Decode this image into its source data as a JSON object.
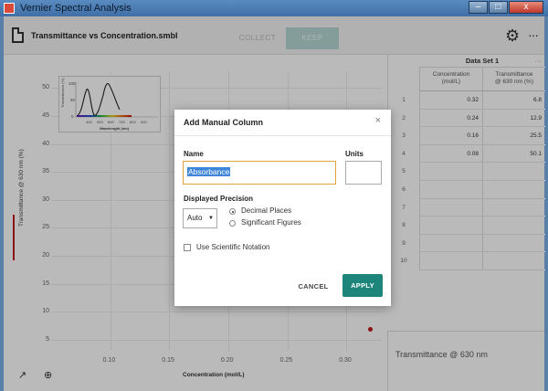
{
  "window": {
    "title": "Vernier Spectral Analysis",
    "buttons": [
      "–",
      "□",
      "x"
    ]
  },
  "toolbar": {
    "file_title": "Transmittance vs Concentration.smbl",
    "collect_label": "COLLECT",
    "keep_label": "KEEP",
    "settings_icon": "gear-icon",
    "more_icon": "ellipsis-icon",
    "more_label": "···",
    "gear_glyph": "⚙"
  },
  "graph": {
    "ylabel": "Transmittance @ 630 nm (%)",
    "xlabel": "Concentration (mol/L)",
    "yticks": [
      "50",
      "45",
      "40",
      "35",
      "30",
      "25",
      "20",
      "15",
      "10",
      "5"
    ],
    "xticks": [
      "0.10",
      "0.15",
      "0.20",
      "0.25",
      "0.30"
    ],
    "inset": {
      "ylabel": "Transmittance (%)",
      "xlabel": "Wavelength (nm)",
      "yticks": [
        "100",
        "50",
        "0"
      ],
      "xticks": [
        "400",
        "500",
        "600",
        "700",
        "800",
        "900"
      ]
    },
    "tools": {
      "graph_icon": "↗",
      "zoom_icon": "⊕"
    }
  },
  "chart_data": {
    "type": "scatter",
    "xlabel": "Concentration (mol/L)",
    "ylabel": "Transmittance @ 630 nm (%)",
    "xlim": [
      0.05,
      0.33
    ],
    "ylim": [
      3,
      53
    ],
    "x": [
      0.32,
      0.24,
      0.16,
      0.08
    ],
    "y": [
      6.8,
      12.9,
      25.5,
      50.1
    ]
  },
  "table": {
    "dataset_title": "Data Set 1",
    "dataset_more": "···",
    "columns": [
      {
        "name": "Concentration",
        "unit": "(mol/L)",
        "more": "···"
      },
      {
        "name": "Transmittance",
        "unit": "@ 630 nm (%)",
        "more": "···"
      }
    ],
    "rows": [
      {
        "n": "1",
        "c": "0.32",
        "t": "6.8"
      },
      {
        "n": "2",
        "c": "0.24",
        "t": "12.9"
      },
      {
        "n": "3",
        "c": "0.16",
        "t": "25.5"
      },
      {
        "n": "4",
        "c": "0.08",
        "t": "50.1"
      },
      {
        "n": "5",
        "c": "",
        "t": ""
      },
      {
        "n": "6",
        "c": "",
        "t": ""
      },
      {
        "n": "7",
        "c": "",
        "t": ""
      },
      {
        "n": "8",
        "c": "",
        "t": ""
      },
      {
        "n": "9",
        "c": "",
        "t": ""
      },
      {
        "n": "10",
        "c": "",
        "t": ""
      }
    ]
  },
  "meter": {
    "label": "Transmittance @ 630 nm"
  },
  "dialog": {
    "title": "Add Manual Column",
    "close_glyph": "×",
    "name_label": "Name",
    "name_value": "Absorbance",
    "units_label": "Units",
    "units_value": "",
    "precision_label": "Displayed Precision",
    "precision_select": "Auto",
    "precision_arrow": "▼",
    "radio_decimal": "Decimal Places",
    "radio_significant": "Significant Figures",
    "radio_selected": "decimal",
    "scientific_label": "Use Scientific Notation",
    "scientific_checked": false,
    "cancel_label": "CANCEL",
    "apply_label": "APPLY"
  }
}
